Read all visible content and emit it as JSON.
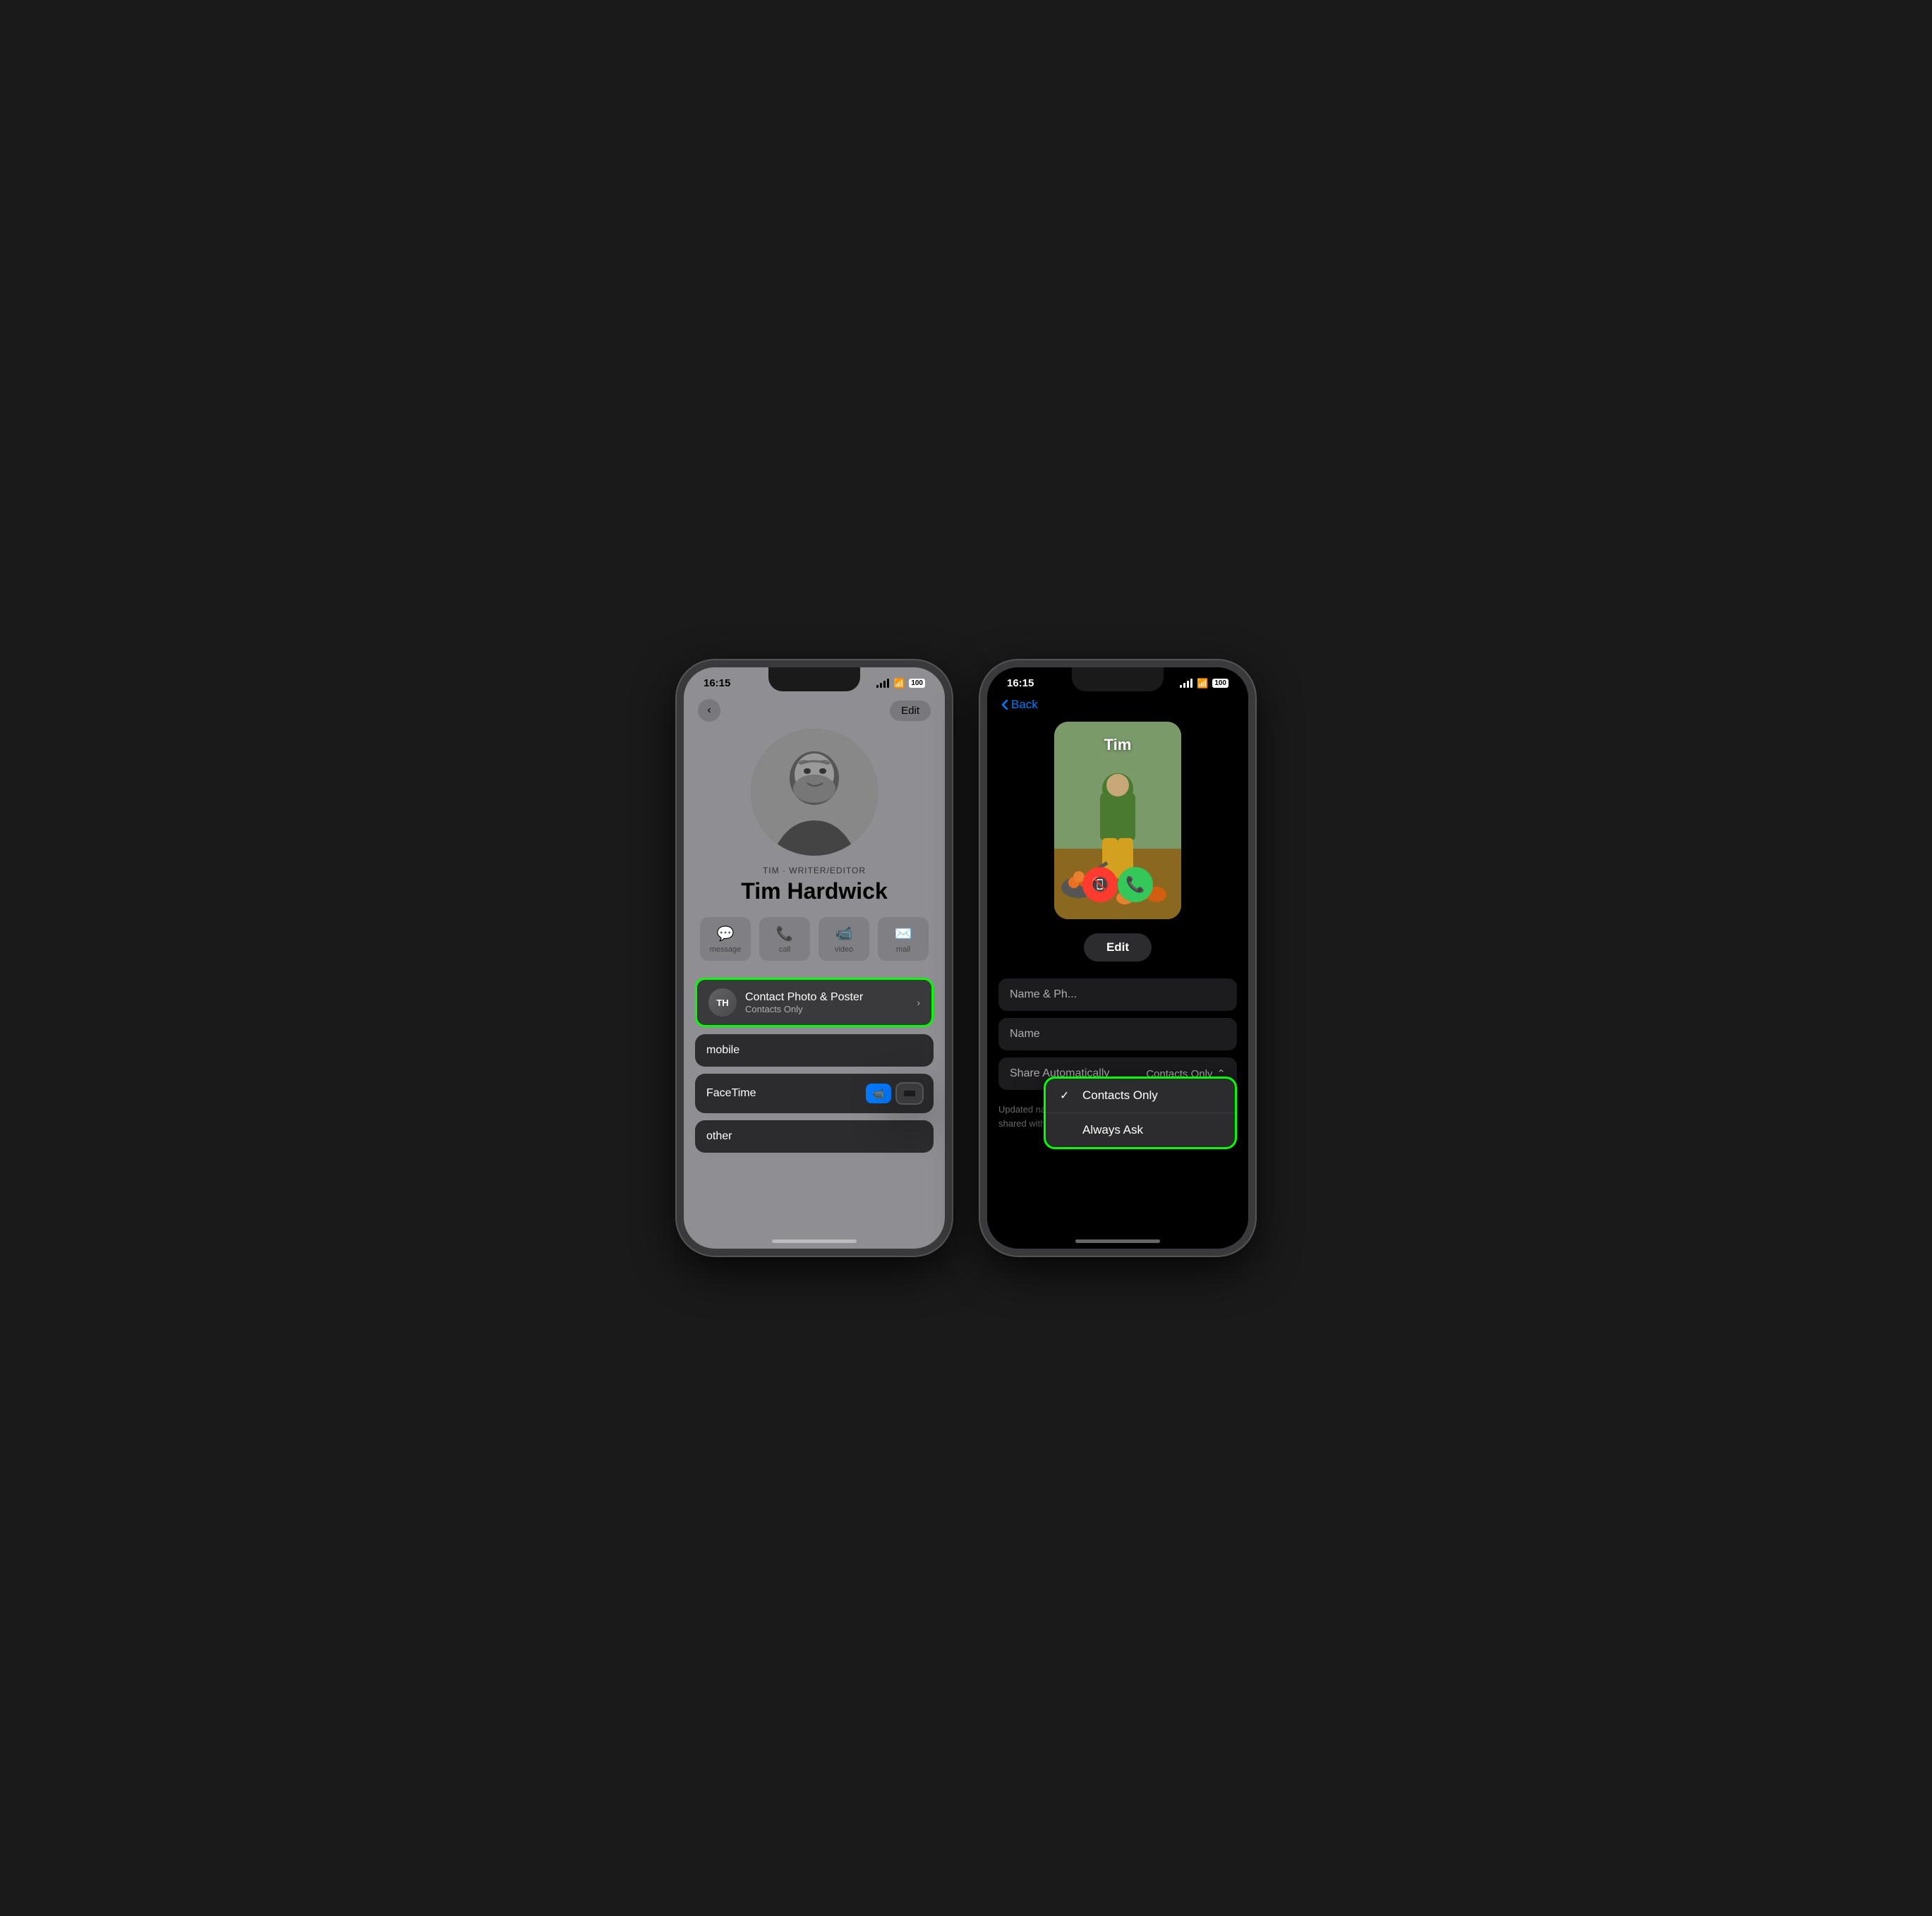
{
  "left_phone": {
    "status": {
      "time": "16:15",
      "battery": "100"
    },
    "header": {
      "back_label": "<",
      "edit_label": "Edit"
    },
    "contact": {
      "subtitle": "TIM · WRITER/EDITOR",
      "name": "Tim Hardwick",
      "initials": "TH"
    },
    "action_buttons": [
      {
        "icon": "💬",
        "label": "message"
      },
      {
        "icon": "📞",
        "label": "call"
      },
      {
        "icon": "📹",
        "label": "video"
      },
      {
        "icon": "✉️",
        "label": "mail"
      }
    ],
    "rows": [
      {
        "type": "poster",
        "title": "Contact Photo & Poster",
        "subtitle": "Contacts Only"
      },
      {
        "type": "simple",
        "label": "mobile"
      },
      {
        "type": "facetime",
        "label": "FaceTime"
      },
      {
        "type": "simple",
        "label": "other"
      }
    ]
  },
  "right_phone": {
    "status": {
      "time": "16:15",
      "battery": "100"
    },
    "back_label": "Back",
    "poster": {
      "name": "Tim"
    },
    "edit_label": "Edit",
    "settings": {
      "name_pronunciation_label": "Name & Ph...",
      "name_label": "Name",
      "share_automatically_label": "Share Automatically",
      "share_automatically_value": "Contacts Only"
    },
    "dropdown": {
      "items": [
        {
          "label": "Contacts Only",
          "selected": true
        },
        {
          "label": "Always Ask",
          "selected": false
        }
      ]
    },
    "note": "Updated name, photo and poster will be automatically shared with people in your contacts."
  }
}
